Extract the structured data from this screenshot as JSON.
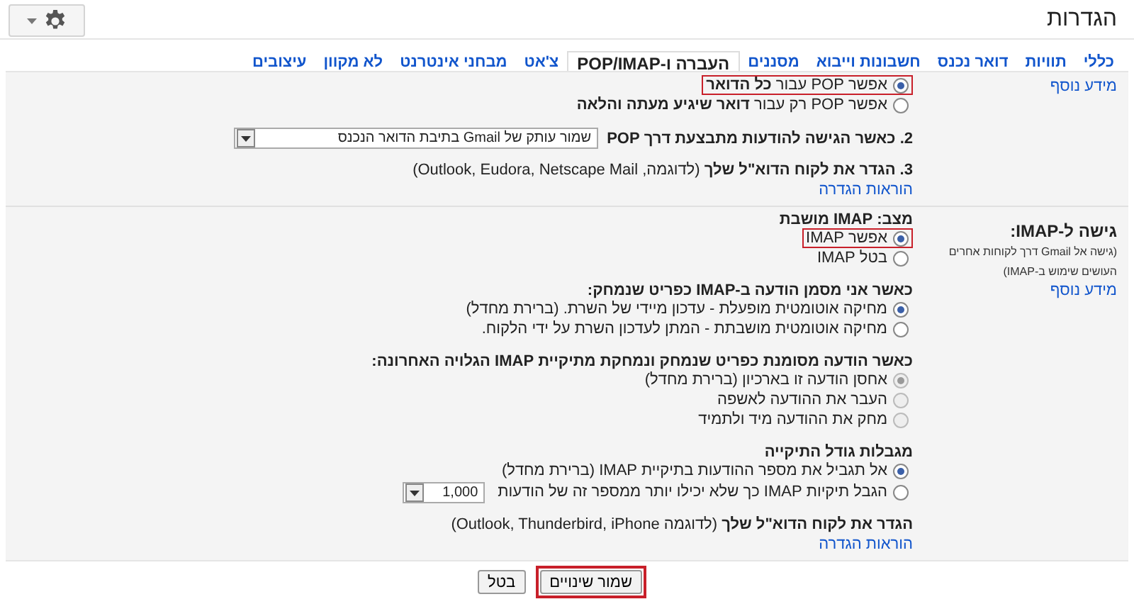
{
  "page_title": "הגדרות",
  "tabs": [
    {
      "label": "כללי",
      "selected": false
    },
    {
      "label": "תוויות",
      "selected": false
    },
    {
      "label": "דואר נכנס",
      "selected": false
    },
    {
      "label": "חשבונות וייבוא",
      "selected": false
    },
    {
      "label": "מסננים",
      "selected": false
    },
    {
      "label": "העברה ו-POP/IMAP",
      "selected": true
    },
    {
      "label": "צ'אט",
      "selected": false
    },
    {
      "label": "מבחני אינטרנט",
      "selected": false
    },
    {
      "label": "לא מקוון",
      "selected": false
    },
    {
      "label": "עיצובים",
      "selected": false
    }
  ],
  "sections": [
    {
      "side": [
        {
          "kind": "link",
          "text": "מידע נוסף"
        }
      ],
      "groups": [
        [
          {
            "kind": "radio",
            "text": "אפשר POP עבור **כל הדואר**",
            "selected": true,
            "disabled": false,
            "highlighted": true
          },
          {
            "kind": "radio",
            "text": "אפשר POP רק עבור **דואר שיגיע מעתה והלאה**",
            "selected": false,
            "disabled": false,
            "highlighted": false
          }
        ],
        [
          {
            "kind": "select_heading",
            "text": "2. כאשר הגישה להודעות מתבצעת דרך POP",
            "value": "שמור עותק של Gmail בתיבת הדואר הנכנס"
          }
        ],
        [
          {
            "kind": "text",
            "text": "**3. הגדר את לקוח הדוא\"ל שלך** (לדוגמה, Outlook, Eudora, Netscape Mail)"
          },
          {
            "kind": "link",
            "text": "הוראות הגדרה"
          }
        ]
      ]
    },
    {
      "side": [
        {
          "kind": "heading",
          "text": "גישה ל-IMAP:"
        },
        {
          "kind": "note",
          "text": "(גישה אל Gmail דרך לקוחות אחרים העושים שימוש ב-IMAP)"
        },
        {
          "kind": "link",
          "text": "מידע נוסף"
        }
      ],
      "groups": [
        [
          {
            "kind": "heading",
            "text": "מצב: IMAP מושבת"
          },
          {
            "kind": "radio",
            "text": "אפשר IMAP",
            "selected": true,
            "disabled": false,
            "highlighted": true
          },
          {
            "kind": "radio",
            "text": "בטל IMAP",
            "selected": false,
            "disabled": false,
            "highlighted": false
          }
        ],
        [
          {
            "kind": "heading",
            "text": "כאשר אני מסמן הודעה ב-IMAP כפריט שנמחק:"
          },
          {
            "kind": "radio",
            "text": "מחיקה אוטומטית מופעלת - עדכון מיידי של השרת. (ברירת מחדל)",
            "selected": true,
            "disabled": false,
            "highlighted": false
          },
          {
            "kind": "radio",
            "text": "מחיקה אוטומטית מושבתת - המתן לעדכון השרת על ידי הלקוח.",
            "selected": false,
            "disabled": false,
            "highlighted": false
          }
        ],
        [
          {
            "kind": "heading",
            "text": "כאשר הודעה מסומנת כפריט שנמחק ונמחקת מתיקיית IMAP הגלויה האחרונה:"
          },
          {
            "kind": "radio",
            "text": "אחסן הודעה זו בארכיון (ברירת מחדל)",
            "selected": true,
            "disabled": true,
            "highlighted": false
          },
          {
            "kind": "radio",
            "text": "העבר את ההודעה לאשפה",
            "selected": false,
            "disabled": true,
            "highlighted": false
          },
          {
            "kind": "radio",
            "text": "מחק את ההודעה מיד ולתמיד",
            "selected": false,
            "disabled": true,
            "highlighted": false
          }
        ],
        [
          {
            "kind": "heading",
            "text": "מגבלות גודל התיקייה"
          },
          {
            "kind": "radio",
            "text": "אל תגביל את מספר ההודעות בתיקיית IMAP (ברירת מחדל)",
            "selected": true,
            "disabled": false,
            "highlighted": false
          },
          {
            "kind": "radio",
            "text": "הגבל תיקיות IMAP כך שלא יכילו יותר ממספר זה של הודעות",
            "selected": false,
            "disabled": false,
            "highlighted": false,
            "value": "1,000"
          }
        ],
        [
          {
            "kind": "text",
            "text": "**הגדר את לקוח הדוא\"ל שלך** (לדוגמה Outlook, Thunderbird, iPhone)"
          },
          {
            "kind": "link",
            "text": "הוראות הגדרה"
          }
        ]
      ]
    }
  ],
  "buttons": [
    {
      "label": "שמור שינויים",
      "highlighted": true
    },
    {
      "label": "בטל",
      "highlighted": false
    }
  ]
}
